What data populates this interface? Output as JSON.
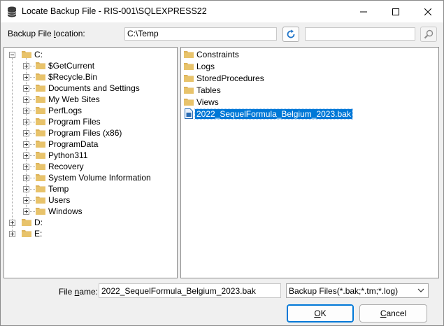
{
  "window": {
    "title": "Locate Backup File - RIS-001\\SQLEXPRESS22"
  },
  "location": {
    "label_prefix": "Backup File ",
    "label_accel": "l",
    "label_suffix": "ocation:",
    "value": "C:\\Temp",
    "search_value": ""
  },
  "tree": {
    "drives": [
      {
        "label": "C:",
        "expanded": true
      },
      {
        "label": "D:",
        "expanded": false
      },
      {
        "label": "E:",
        "expanded": false
      }
    ],
    "c_children": [
      "$GetCurrent",
      "$Recycle.Bin",
      "Documents and Settings",
      "My Web Sites",
      "PerfLogs",
      "Program Files",
      "Program Files (x86)",
      "ProgramData",
      "Python311",
      "Recovery",
      "System Volume Information",
      "Temp",
      "Users",
      "Windows"
    ]
  },
  "files": {
    "folders": [
      "Constraints",
      "Logs",
      "StoredProcedures",
      "Tables",
      "Views"
    ],
    "backup_file": "2022_SequelFormula_Belgium_2023.bak"
  },
  "footer": {
    "filename_label_prefix": "File ",
    "filename_label_accel": "n",
    "filename_label_suffix": "ame:",
    "filename_value": "2022_SequelFormula_Belgium_2023.bak",
    "filter_value": "Backup Files(*.bak;*.tm;*.log)",
    "ok_accel": "O",
    "ok_rest": "K",
    "cancel_accel": "C",
    "cancel_rest": "ancel"
  },
  "colors": {
    "selection": "#0078d7",
    "folder": "#dcb25a",
    "accent": "#0078d7"
  }
}
